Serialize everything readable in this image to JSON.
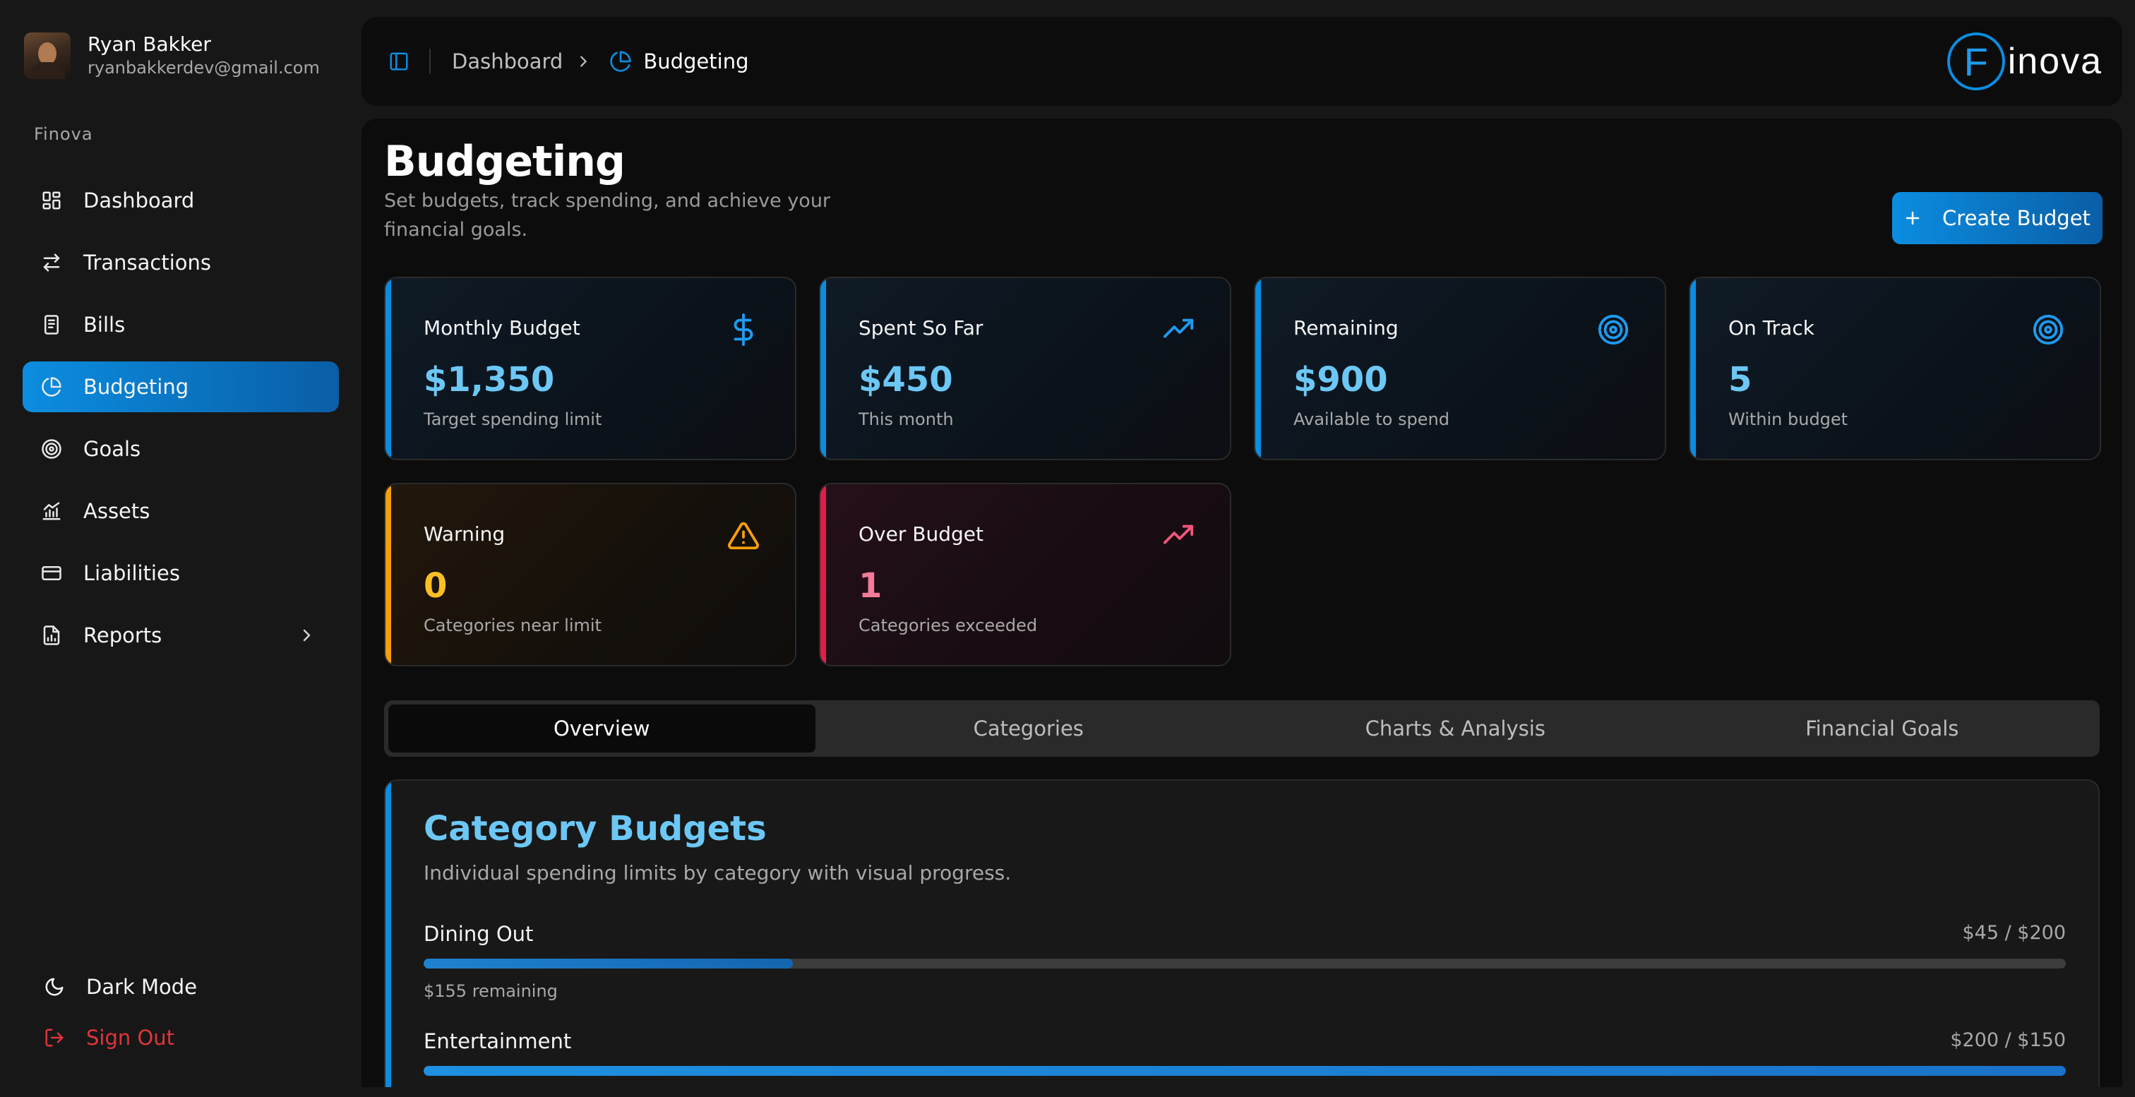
{
  "user": {
    "name": "Ryan Bakker",
    "email": "ryanbakkerdev@gmail.com"
  },
  "sidebar": {
    "section_label": "Finova",
    "items": [
      {
        "label": "Dashboard",
        "icon": "dashboard-grid-icon",
        "active": false
      },
      {
        "label": "Transactions",
        "icon": "arrows-left-right-icon",
        "active": false
      },
      {
        "label": "Bills",
        "icon": "receipt-icon",
        "active": false
      },
      {
        "label": "Budgeting",
        "icon": "pie-chart-icon",
        "active": true
      },
      {
        "label": "Goals",
        "icon": "target-icon",
        "active": false
      },
      {
        "label": "Assets",
        "icon": "bar-chart-icon",
        "active": false
      },
      {
        "label": "Liabilities",
        "icon": "credit-card-icon",
        "active": false
      },
      {
        "label": "Reports",
        "icon": "report-icon",
        "active": false,
        "has_submenu": true
      }
    ],
    "dark_mode_label": "Dark Mode",
    "sign_out_label": "Sign Out"
  },
  "topbar": {
    "breadcrumb_root": "Dashboard",
    "breadcrumb_current": "Budgeting",
    "logo_letter": "F",
    "logo_text": "inova"
  },
  "page": {
    "title": "Budgeting",
    "subtitle": "Set budgets, track spending, and achieve your financial goals.",
    "create_button": "Create Budget"
  },
  "cards": [
    {
      "title": "Monthly Budget",
      "value": "$1,350",
      "sub": "Target spending limit",
      "icon": "dollar-icon",
      "variant": "info"
    },
    {
      "title": "Spent So Far",
      "value": "$450",
      "sub": "This month",
      "icon": "trending-up-icon",
      "variant": "info"
    },
    {
      "title": "Remaining",
      "value": "$900",
      "sub": "Available to spend",
      "icon": "target-icon",
      "variant": "info"
    },
    {
      "title": "On Track",
      "value": "5",
      "sub": "Within budget",
      "icon": "target-icon",
      "variant": "info"
    },
    {
      "title": "Warning",
      "value": "0",
      "sub": "Categories near limit",
      "icon": "warning-triangle-icon",
      "variant": "warning"
    },
    {
      "title": "Over Budget",
      "value": "1",
      "sub": "Categories exceeded",
      "icon": "trending-up-icon",
      "variant": "danger"
    }
  ],
  "tabs": [
    {
      "label": "Overview",
      "active": true
    },
    {
      "label": "Categories",
      "active": false
    },
    {
      "label": "Charts & Analysis",
      "active": false
    },
    {
      "label": "Financial Goals",
      "active": false
    }
  ],
  "category_budgets": {
    "title": "Category Budgets",
    "subtitle": "Individual spending limits by category with visual progress.",
    "items": [
      {
        "name": "Dining Out",
        "amount": "$45 / $200",
        "progress": 0.225,
        "remaining": "$155 remaining"
      },
      {
        "name": "Entertainment",
        "amount": "$200 / $150",
        "progress": 1.0,
        "remaining": ""
      }
    ]
  },
  "colors": {
    "accent": "#0a8de0",
    "warning": "#f59e0b",
    "danger": "#e11d48",
    "value_blue": "#6cc7f5"
  }
}
